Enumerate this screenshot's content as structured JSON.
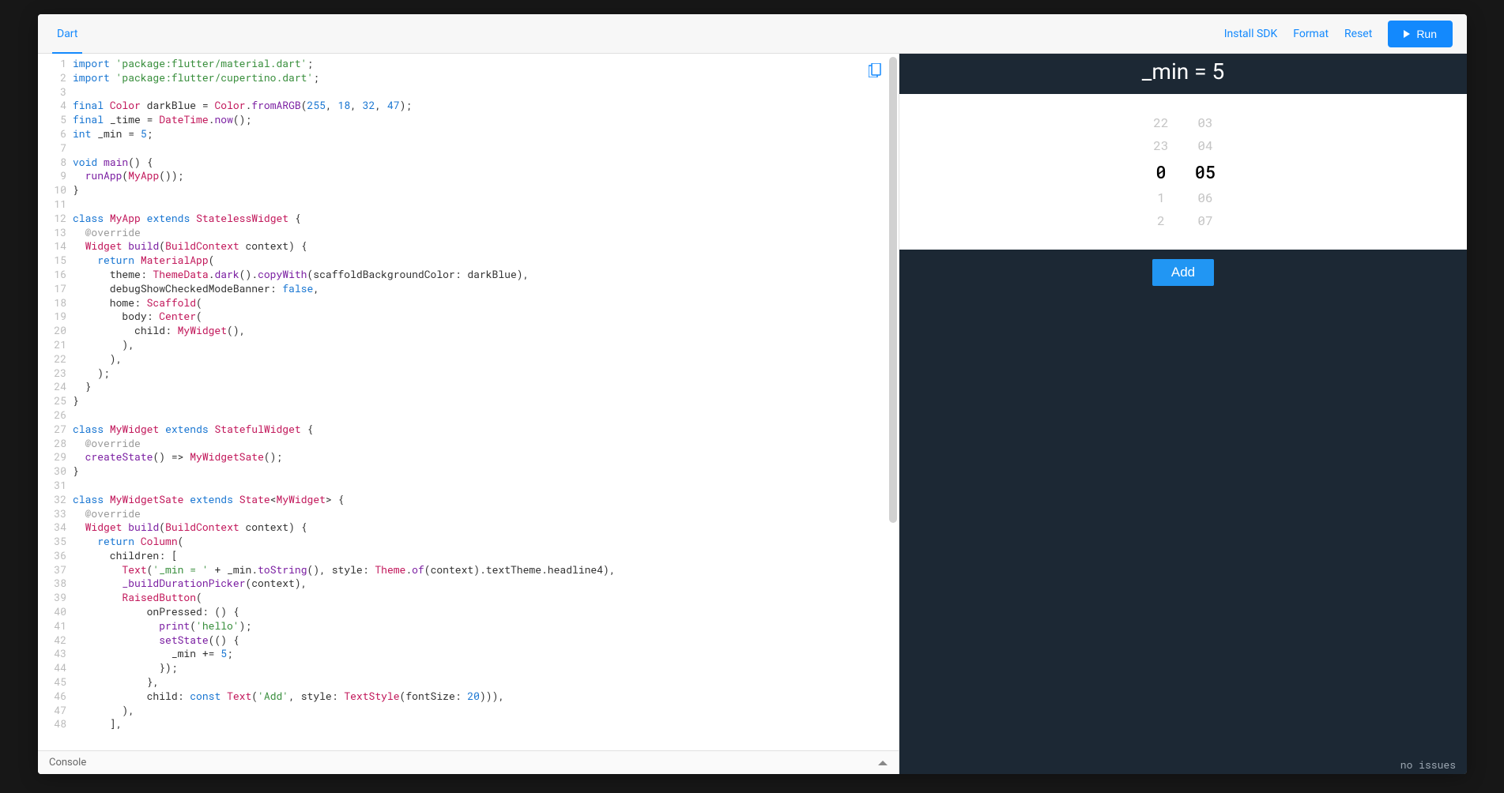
{
  "header": {
    "tab": "Dart",
    "install_sdk": "Install SDK",
    "format": "Format",
    "reset": "Reset",
    "run": "Run"
  },
  "editor": {
    "console_label": "Console",
    "code_lines": [
      [
        [
          "kw",
          "import"
        ],
        [
          "",
          " "
        ],
        [
          "st",
          "'package:flutter/material.dart'"
        ],
        [
          "",
          ";"
        ]
      ],
      [
        [
          "kw",
          "import"
        ],
        [
          "",
          " "
        ],
        [
          "st",
          "'package:flutter/cupertino.dart'"
        ],
        [
          "",
          ";"
        ]
      ],
      [],
      [
        [
          "kw",
          "final"
        ],
        [
          "",
          " "
        ],
        [
          "ty",
          "Color"
        ],
        [
          "",
          " darkBlue = "
        ],
        [
          "ty",
          "Color"
        ],
        [
          "",
          "."
        ],
        [
          "mt",
          "fromARGB"
        ],
        [
          "",
          "("
        ],
        [
          "nu",
          "255"
        ],
        [
          "",
          ", "
        ],
        [
          "nu",
          "18"
        ],
        [
          "",
          ", "
        ],
        [
          "nu",
          "32"
        ],
        [
          "",
          ", "
        ],
        [
          "nu",
          "47"
        ],
        [
          "",
          ");"
        ]
      ],
      [
        [
          "kw",
          "final"
        ],
        [
          "",
          " _time = "
        ],
        [
          "ty",
          "DateTime"
        ],
        [
          "",
          "."
        ],
        [
          "mt",
          "now"
        ],
        [
          "",
          "();"
        ]
      ],
      [
        [
          "kw",
          "int"
        ],
        [
          "",
          " _min = "
        ],
        [
          "nu",
          "5"
        ],
        [
          "",
          ";"
        ]
      ],
      [],
      [
        [
          "kw",
          "void"
        ],
        [
          "",
          " "
        ],
        [
          "mt",
          "main"
        ],
        [
          "",
          "() {"
        ]
      ],
      [
        [
          "",
          "  "
        ],
        [
          "mt",
          "runApp"
        ],
        [
          "",
          "("
        ],
        [
          "ty",
          "MyApp"
        ],
        [
          "",
          "());"
        ]
      ],
      [
        [
          "",
          "}"
        ]
      ],
      [],
      [
        [
          "kw",
          "class"
        ],
        [
          "",
          " "
        ],
        [
          "ty",
          "MyApp"
        ],
        [
          "",
          " "
        ],
        [
          "kw",
          "extends"
        ],
        [
          "",
          " "
        ],
        [
          "ty",
          "StatelessWidget"
        ],
        [
          "",
          " {"
        ]
      ],
      [
        [
          "",
          "  "
        ],
        [
          "an",
          "@override"
        ]
      ],
      [
        [
          "",
          "  "
        ],
        [
          "ty",
          "Widget"
        ],
        [
          "",
          " "
        ],
        [
          "mt",
          "build"
        ],
        [
          "",
          "("
        ],
        [
          "ty",
          "BuildContext"
        ],
        [
          "",
          " context) {"
        ]
      ],
      [
        [
          "",
          "    "
        ],
        [
          "kw",
          "return"
        ],
        [
          "",
          " "
        ],
        [
          "ty",
          "MaterialApp"
        ],
        [
          "",
          "("
        ]
      ],
      [
        [
          "",
          "      theme: "
        ],
        [
          "ty",
          "ThemeData"
        ],
        [
          "",
          "."
        ],
        [
          "mt",
          "dark"
        ],
        [
          "",
          "()."
        ],
        [
          "mt",
          "copyWith"
        ],
        [
          "",
          "(scaffoldBackgroundColor: darkBlue),"
        ]
      ],
      [
        [
          "",
          "      debugShowCheckedModeBanner: "
        ],
        [
          "kw",
          "false"
        ],
        [
          "",
          ","
        ]
      ],
      [
        [
          "",
          "      home: "
        ],
        [
          "ty",
          "Scaffold"
        ],
        [
          "",
          "("
        ]
      ],
      [
        [
          "",
          "        body: "
        ],
        [
          "ty",
          "Center"
        ],
        [
          "",
          "("
        ]
      ],
      [
        [
          "",
          "          child: "
        ],
        [
          "ty",
          "MyWidget"
        ],
        [
          "",
          "(),"
        ]
      ],
      [
        [
          "",
          "        ),"
        ]
      ],
      [
        [
          "",
          "      ),"
        ]
      ],
      [
        [
          "",
          "    );"
        ]
      ],
      [
        [
          "",
          "  }"
        ]
      ],
      [
        [
          "",
          "}"
        ]
      ],
      [],
      [
        [
          "kw",
          "class"
        ],
        [
          "",
          " "
        ],
        [
          "ty",
          "MyWidget"
        ],
        [
          "",
          " "
        ],
        [
          "kw",
          "extends"
        ],
        [
          "",
          " "
        ],
        [
          "ty",
          "StatefulWidget"
        ],
        [
          "",
          " {"
        ]
      ],
      [
        [
          "",
          "  "
        ],
        [
          "an",
          "@override"
        ]
      ],
      [
        [
          "",
          "  "
        ],
        [
          "mt",
          "createState"
        ],
        [
          "",
          "() => "
        ],
        [
          "ty",
          "MyWidgetSate"
        ],
        [
          "",
          "();"
        ]
      ],
      [
        [
          "",
          "}"
        ]
      ],
      [],
      [
        [
          "kw",
          "class"
        ],
        [
          "",
          " "
        ],
        [
          "ty",
          "MyWidgetSate"
        ],
        [
          "",
          " "
        ],
        [
          "kw",
          "extends"
        ],
        [
          "",
          " "
        ],
        [
          "ty",
          "State"
        ],
        [
          "",
          "<"
        ],
        [
          "ty",
          "MyWidget"
        ],
        [
          "",
          "> {"
        ]
      ],
      [
        [
          "",
          "  "
        ],
        [
          "an",
          "@override"
        ]
      ],
      [
        [
          "",
          "  "
        ],
        [
          "ty",
          "Widget"
        ],
        [
          "",
          " "
        ],
        [
          "mt",
          "build"
        ],
        [
          "",
          "("
        ],
        [
          "ty",
          "BuildContext"
        ],
        [
          "",
          " context) {"
        ]
      ],
      [
        [
          "",
          "    "
        ],
        [
          "kw",
          "return"
        ],
        [
          "",
          " "
        ],
        [
          "ty",
          "Column"
        ],
        [
          "",
          "("
        ]
      ],
      [
        [
          "",
          "      children: ["
        ]
      ],
      [
        [
          "",
          "        "
        ],
        [
          "ty",
          "Text"
        ],
        [
          "",
          "("
        ],
        [
          "st",
          "'_min = '"
        ],
        [
          "",
          " + _min."
        ],
        [
          "mt",
          "toString"
        ],
        [
          "",
          "(), style: "
        ],
        [
          "ty",
          "Theme"
        ],
        [
          "",
          "."
        ],
        [
          "mt",
          "of"
        ],
        [
          "",
          "(context).textTheme.headline4),"
        ]
      ],
      [
        [
          "",
          "        "
        ],
        [
          "mt",
          "_buildDurationPicker"
        ],
        [
          "",
          "(context),"
        ]
      ],
      [
        [
          "",
          "        "
        ],
        [
          "ty",
          "RaisedButton"
        ],
        [
          "",
          "("
        ]
      ],
      [
        [
          "",
          "            onPressed: () {"
        ]
      ],
      [
        [
          "",
          "              "
        ],
        [
          "mt",
          "print"
        ],
        [
          "",
          "("
        ],
        [
          "st",
          "'hello'"
        ],
        [
          "",
          ");"
        ]
      ],
      [
        [
          "",
          "              "
        ],
        [
          "mt",
          "setState"
        ],
        [
          "",
          "(() {"
        ]
      ],
      [
        [
          "",
          "                _min += "
        ],
        [
          "nu",
          "5"
        ],
        [
          "",
          ";"
        ]
      ],
      [
        [
          "",
          "              });"
        ]
      ],
      [
        [
          "",
          "            },"
        ]
      ],
      [
        [
          "",
          "            child: "
        ],
        [
          "kw",
          "const"
        ],
        [
          "",
          " "
        ],
        [
          "ty",
          "Text"
        ],
        [
          "",
          "("
        ],
        [
          "st",
          "'Add'"
        ],
        [
          "",
          ", style: "
        ],
        [
          "ty",
          "TextStyle"
        ],
        [
          "",
          "(fontSize: "
        ],
        [
          "nu",
          "20"
        ],
        [
          "",
          "))),"
        ]
      ],
      [
        [
          "",
          "        ),"
        ]
      ],
      [
        [
          "",
          "      ],"
        ]
      ]
    ]
  },
  "preview": {
    "title": "_min = 5",
    "picker": {
      "hours": [
        "22",
        "23",
        "0",
        "1",
        "2"
      ],
      "minutes": [
        "03",
        "04",
        "05",
        "06",
        "07"
      ]
    },
    "add_label": "Add",
    "status": "no issues"
  }
}
